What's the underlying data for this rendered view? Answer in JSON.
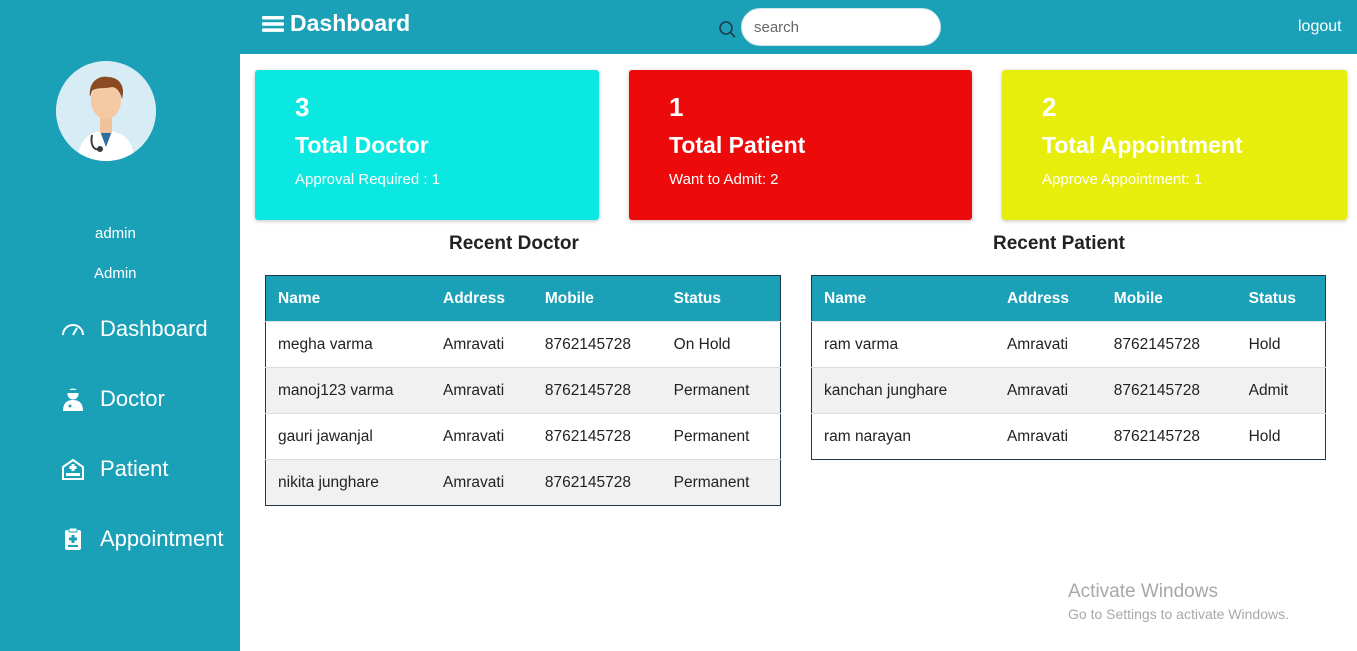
{
  "header": {
    "title": "Dashboard",
    "search_placeholder": "search",
    "logout": "logout"
  },
  "sidebar": {
    "user_name": "admin",
    "user_role": "Admin",
    "items": [
      {
        "label": "Dashboard",
        "icon": "gauge-icon"
      },
      {
        "label": "Doctor",
        "icon": "doctor-icon"
      },
      {
        "label": "Patient",
        "icon": "patient-bed-icon"
      },
      {
        "label": "Appointment",
        "icon": "clipboard-medical-icon"
      }
    ]
  },
  "cards": [
    {
      "count": "3",
      "title": "Total Doctor",
      "subtitle": "Approval Required : 1",
      "color": "#0ae8e1"
    },
    {
      "count": "1",
      "title": "Total Patient",
      "subtitle": "Want to Admit: 2",
      "color": "#ec0a0a"
    },
    {
      "count": "2",
      "title": "Total Appointment",
      "subtitle": "Approve Appointment: 1",
      "color": "#e8ee0b"
    }
  ],
  "recent_doctor": {
    "title": "Recent Doctor",
    "columns": [
      "Name",
      "Address",
      "Mobile",
      "Status"
    ],
    "rows": [
      [
        "megha varma",
        "Amravati",
        "8762145728",
        "On Hold"
      ],
      [
        "manoj123 varma",
        "Amravati",
        "8762145728",
        "Permanent"
      ],
      [
        "gauri jawanjal",
        "Amravati",
        "8762145728",
        "Permanent"
      ],
      [
        "nikita junghare",
        "Amravati",
        "8762145728",
        "Permanent"
      ]
    ]
  },
  "recent_patient": {
    "title": "Recent Patient",
    "columns": [
      "Name",
      "Address",
      "Mobile",
      "Status"
    ],
    "rows": [
      [
        "ram varma",
        "Amravati",
        "8762145728",
        "Hold"
      ],
      [
        "kanchan junghare",
        "Amravati",
        "8762145728",
        "Admit"
      ],
      [
        "ram narayan",
        "Amravati",
        "8762145728",
        "Hold"
      ]
    ]
  },
  "watermark": {
    "title": "Activate Windows",
    "subtitle": "Go to Settings to activate Windows."
  },
  "colors": {
    "primary": "#1aa1b8",
    "text": "#222222"
  }
}
